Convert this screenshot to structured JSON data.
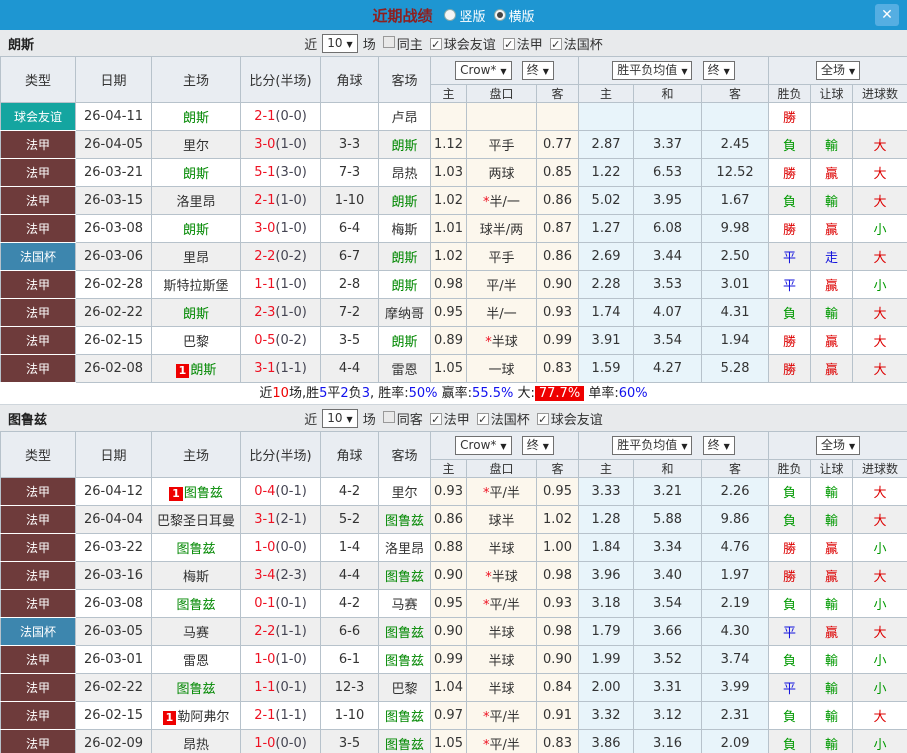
{
  "titlebar": {
    "title": "近期战绩",
    "radio_vertical": "竖版",
    "radio_horizontal": "横版",
    "close_glyph": "✕"
  },
  "colors": {
    "topbar": "#1e96d2",
    "friendly": "#14a5a0",
    "ligue1": "#6e3b3b",
    "cup": "#3d86ae",
    "win": "#dd0000",
    "loss": "#009900",
    "draw": "#1111dd",
    "team_highlight": "#008800",
    "summary_highlight": "#ee0000"
  },
  "table_header": {
    "type": "类型",
    "date": "日期",
    "home": "主场",
    "score": "比分(半场)",
    "corner": "角球",
    "away": "客场",
    "h": "主",
    "line": "盘口",
    "a": "客",
    "h2": "主",
    "d": "和",
    "a2": "客",
    "res": "胜负",
    "han": "让球",
    "goal": "进球数",
    "sel_crow": "Crow*",
    "sel_final": "终",
    "sel_avg": "胜平负均值",
    "sel_scope": "全场"
  },
  "sections": [
    {
      "team": "朗斯",
      "filter": {
        "near": "近",
        "count": "10",
        "games": "场",
        "checks": [
          {
            "label": "同主",
            "checked": false
          },
          {
            "label": "球会友谊",
            "checked": true
          },
          {
            "label": "法甲",
            "checked": true
          },
          {
            "label": "法国杯",
            "checked": true
          }
        ]
      },
      "rows": [
        {
          "type": "球会友谊",
          "type_c": "friendly",
          "date": "26-04-11",
          "badge": "",
          "home": "朗斯",
          "home_c": "gr",
          "score": "2-1",
          "half": "(0-0)",
          "corner": "",
          "away": "卢昂",
          "away_c": "",
          "o_h": "",
          "o_star": "",
          "o_line": "",
          "o_a": "",
          "e_h": "",
          "e_d": "",
          "e_a": "",
          "res": "勝",
          "res_c": "r",
          "han": "",
          "han_c": "",
          "goal": "",
          "goal_c": ""
        },
        {
          "type": "法甲",
          "type_c": "ligue",
          "date": "26-04-05",
          "badge": "",
          "home": "里尔",
          "home_c": "",
          "score": "3-0",
          "half": "(1-0)",
          "corner": "3-3",
          "away": "朗斯",
          "away_c": "gr",
          "o_h": "1.12",
          "o_star": "",
          "o_line": "平手",
          "o_a": "0.77",
          "e_h": "2.87",
          "e_d": "3.37",
          "e_a": "2.45",
          "res": "負",
          "res_c": "g",
          "han": "輸",
          "han_c": "g",
          "goal": "大",
          "goal_c": "r"
        },
        {
          "type": "法甲",
          "type_c": "ligue",
          "date": "26-03-21",
          "badge": "",
          "home": "朗斯",
          "home_c": "gr",
          "score": "5-1",
          "half": "(3-0)",
          "corner": "7-3",
          "away": "昂热",
          "away_c": "",
          "o_h": "1.03",
          "o_star": "",
          "o_line": "两球",
          "o_a": "0.85",
          "e_h": "1.22",
          "e_d": "6.53",
          "e_a": "12.52",
          "res": "勝",
          "res_c": "r",
          "han": "贏",
          "han_c": "r",
          "goal": "大",
          "goal_c": "r"
        },
        {
          "type": "法甲",
          "type_c": "ligue",
          "date": "26-03-15",
          "badge": "",
          "home": "洛里昂",
          "home_c": "",
          "score": "2-1",
          "half": "(1-0)",
          "corner": "1-10",
          "away": "朗斯",
          "away_c": "gr",
          "o_h": "1.02",
          "o_star": "*",
          "o_line": "半/一",
          "o_a": "0.86",
          "e_h": "5.02",
          "e_d": "3.95",
          "e_a": "1.67",
          "res": "負",
          "res_c": "g",
          "han": "輸",
          "han_c": "g",
          "goal": "大",
          "goal_c": "r"
        },
        {
          "type": "法甲",
          "type_c": "ligue",
          "date": "26-03-08",
          "badge": "",
          "home": "朗斯",
          "home_c": "gr",
          "score": "3-0",
          "half": "(1-0)",
          "corner": "6-4",
          "away": "梅斯",
          "away_c": "",
          "o_h": "1.01",
          "o_star": "",
          "o_line": "球半/两",
          "o_a": "0.87",
          "e_h": "1.27",
          "e_d": "6.08",
          "e_a": "9.98",
          "res": "勝",
          "res_c": "r",
          "han": "贏",
          "han_c": "r",
          "goal": "小",
          "goal_c": "g"
        },
        {
          "type": "法国杯",
          "type_c": "cup",
          "date": "26-03-06",
          "badge": "",
          "home": "里昂",
          "home_c": "",
          "score": "2-2",
          "half": "(0-2)",
          "corner": "6-7",
          "away": "朗斯",
          "away_c": "gr",
          "o_h": "1.02",
          "o_star": "",
          "o_line": "平手",
          "o_a": "0.86",
          "e_h": "2.69",
          "e_d": "3.44",
          "e_a": "2.50",
          "res": "平",
          "res_c": "b",
          "han": "走",
          "han_c": "b",
          "goal": "大",
          "goal_c": "r"
        },
        {
          "type": "法甲",
          "type_c": "ligue",
          "date": "26-02-28",
          "badge": "",
          "home": "斯特拉斯堡",
          "home_c": "",
          "score": "1-1",
          "half": "(1-0)",
          "corner": "2-8",
          "away": "朗斯",
          "away_c": "gr",
          "o_h": "0.98",
          "o_star": "",
          "o_line": "平/半",
          "o_a": "0.90",
          "e_h": "2.28",
          "e_d": "3.53",
          "e_a": "3.01",
          "res": "平",
          "res_c": "b",
          "han": "贏",
          "han_c": "r",
          "goal": "小",
          "goal_c": "g"
        },
        {
          "type": "法甲",
          "type_c": "ligue",
          "date": "26-02-22",
          "badge": "",
          "home": "朗斯",
          "home_c": "gr",
          "score": "2-3",
          "half": "(1-0)",
          "corner": "7-2",
          "away": "摩纳哥",
          "away_c": "",
          "o_h": "0.95",
          "o_star": "",
          "o_line": "半/一",
          "o_a": "0.93",
          "e_h": "1.74",
          "e_d": "4.07",
          "e_a": "4.31",
          "res": "負",
          "res_c": "g",
          "han": "輸",
          "han_c": "g",
          "goal": "大",
          "goal_c": "r"
        },
        {
          "type": "法甲",
          "type_c": "ligue",
          "date": "26-02-15",
          "badge": "",
          "home": "巴黎",
          "home_c": "",
          "score": "0-5",
          "half": "(0-2)",
          "corner": "3-5",
          "away": "朗斯",
          "away_c": "gr",
          "o_h": "0.89",
          "o_star": "*",
          "o_line": "半球",
          "o_a": "0.99",
          "e_h": "3.91",
          "e_d": "3.54",
          "e_a": "1.94",
          "res": "勝",
          "res_c": "r",
          "han": "贏",
          "han_c": "r",
          "goal": "大",
          "goal_c": "r"
        },
        {
          "type": "法甲",
          "type_c": "ligue",
          "date": "26-02-08",
          "badge": "1",
          "home": "朗斯",
          "home_c": "gr",
          "score": "3-1",
          "half": "(1-1)",
          "corner": "4-4",
          "away": "雷恩",
          "away_c": "",
          "o_h": "1.05",
          "o_star": "",
          "o_line": "一球",
          "o_a": "0.83",
          "e_h": "1.59",
          "e_d": "4.27",
          "e_a": "5.28",
          "res": "勝",
          "res_c": "r",
          "han": "贏",
          "han_c": "r",
          "goal": "大",
          "goal_c": "r"
        }
      ],
      "summary": [
        {
          "t": "近",
          "c": "k"
        },
        {
          "t": "10",
          "c": "r"
        },
        {
          "t": "场,胜",
          "c": "k"
        },
        {
          "t": "5",
          "c": "b"
        },
        {
          "t": "平",
          "c": "k"
        },
        {
          "t": "2",
          "c": "b"
        },
        {
          "t": "负",
          "c": "k"
        },
        {
          "t": "3",
          "c": "b"
        },
        {
          "t": ", 胜率:",
          "c": "k"
        },
        {
          "t": "50%",
          "c": "b"
        },
        {
          "t": " 赢率:",
          "c": "k"
        },
        {
          "t": "55.5%",
          "c": "b"
        },
        {
          "t": " 大:",
          "c": "k"
        },
        {
          "t": "77.7%",
          "c": "hl"
        },
        {
          "t": " 单率:",
          "c": "k"
        },
        {
          "t": "60%",
          "c": "b"
        }
      ]
    },
    {
      "team": "图鲁兹",
      "filter": {
        "near": "近",
        "count": "10",
        "games": "场",
        "checks": [
          {
            "label": "同客",
            "checked": false
          },
          {
            "label": "法甲",
            "checked": true
          },
          {
            "label": "法国杯",
            "checked": true
          },
          {
            "label": "球会友谊",
            "checked": true
          }
        ]
      },
      "rows": [
        {
          "type": "法甲",
          "type_c": "ligue",
          "date": "26-04-12",
          "badge": "1",
          "home": "图鲁兹",
          "home_c": "gr",
          "score": "0-4",
          "half": "(0-1)",
          "corner": "4-2",
          "away": "里尔",
          "away_c": "",
          "o_h": "0.93",
          "o_star": "*",
          "o_line": "平/半",
          "o_a": "0.95",
          "e_h": "3.33",
          "e_d": "3.21",
          "e_a": "2.26",
          "res": "負",
          "res_c": "g",
          "han": "輸",
          "han_c": "g",
          "goal": "大",
          "goal_c": "r"
        },
        {
          "type": "法甲",
          "type_c": "ligue",
          "date": "26-04-04",
          "badge": "",
          "home": "巴黎圣日耳曼",
          "home_c": "",
          "score": "3-1",
          "half": "(2-1)",
          "corner": "5-2",
          "away": "图鲁兹",
          "away_c": "gr",
          "o_h": "0.86",
          "o_star": "",
          "o_line": "球半",
          "o_a": "1.02",
          "e_h": "1.28",
          "e_d": "5.88",
          "e_a": "9.86",
          "res": "負",
          "res_c": "g",
          "han": "輸",
          "han_c": "g",
          "goal": "大",
          "goal_c": "r"
        },
        {
          "type": "法甲",
          "type_c": "ligue",
          "date": "26-03-22",
          "badge": "",
          "home": "图鲁兹",
          "home_c": "gr",
          "score": "1-0",
          "half": "(0-0)",
          "corner": "1-4",
          "away": "洛里昂",
          "away_c": "",
          "o_h": "0.88",
          "o_star": "",
          "o_line": "半球",
          "o_a": "1.00",
          "e_h": "1.84",
          "e_d": "3.34",
          "e_a": "4.76",
          "res": "勝",
          "res_c": "r",
          "han": "贏",
          "han_c": "r",
          "goal": "小",
          "goal_c": "g"
        },
        {
          "type": "法甲",
          "type_c": "ligue",
          "date": "26-03-16",
          "badge": "",
          "home": "梅斯",
          "home_c": "",
          "score": "3-4",
          "half": "(2-3)",
          "corner": "4-4",
          "away": "图鲁兹",
          "away_c": "gr",
          "o_h": "0.90",
          "o_star": "*",
          "o_line": "半球",
          "o_a": "0.98",
          "e_h": "3.96",
          "e_d": "3.40",
          "e_a": "1.97",
          "res": "勝",
          "res_c": "r",
          "han": "贏",
          "han_c": "r",
          "goal": "大",
          "goal_c": "r"
        },
        {
          "type": "法甲",
          "type_c": "ligue",
          "date": "26-03-08",
          "badge": "",
          "home": "图鲁兹",
          "home_c": "gr",
          "score": "0-1",
          "half": "(0-1)",
          "corner": "4-2",
          "away": "马赛",
          "away_c": "",
          "o_h": "0.95",
          "o_star": "*",
          "o_line": "平/半",
          "o_a": "0.93",
          "e_h": "3.18",
          "e_d": "3.54",
          "e_a": "2.19",
          "res": "負",
          "res_c": "g",
          "han": "輸",
          "han_c": "g",
          "goal": "小",
          "goal_c": "g"
        },
        {
          "type": "法国杯",
          "type_c": "cup",
          "date": "26-03-05",
          "badge": "",
          "home": "马赛",
          "home_c": "",
          "score": "2-2",
          "half": "(1-1)",
          "corner": "6-6",
          "away": "图鲁兹",
          "away_c": "gr",
          "o_h": "0.90",
          "o_star": "",
          "o_line": "半球",
          "o_a": "0.98",
          "e_h": "1.79",
          "e_d": "3.66",
          "e_a": "4.30",
          "res": "平",
          "res_c": "b",
          "han": "贏",
          "han_c": "r",
          "goal": "大",
          "goal_c": "r"
        },
        {
          "type": "法甲",
          "type_c": "ligue",
          "date": "26-03-01",
          "badge": "",
          "home": "雷恩",
          "home_c": "",
          "score": "1-0",
          "half": "(1-0)",
          "corner": "6-1",
          "away": "图鲁兹",
          "away_c": "gr",
          "o_h": "0.99",
          "o_star": "",
          "o_line": "半球",
          "o_a": "0.90",
          "e_h": "1.99",
          "e_d": "3.52",
          "e_a": "3.74",
          "res": "負",
          "res_c": "g",
          "han": "輸",
          "han_c": "g",
          "goal": "小",
          "goal_c": "g"
        },
        {
          "type": "法甲",
          "type_c": "ligue",
          "date": "26-02-22",
          "badge": "",
          "home": "图鲁兹",
          "home_c": "gr",
          "score": "1-1",
          "half": "(0-1)",
          "corner": "12-3",
          "away": "巴黎",
          "away_c": "",
          "o_h": "1.04",
          "o_star": "",
          "o_line": "半球",
          "o_a": "0.84",
          "e_h": "2.00",
          "e_d": "3.31",
          "e_a": "3.99",
          "res": "平",
          "res_c": "b",
          "han": "輸",
          "han_c": "g",
          "goal": "小",
          "goal_c": "g"
        },
        {
          "type": "法甲",
          "type_c": "ligue",
          "date": "26-02-15",
          "badge": "1",
          "home": "勒阿弗尔",
          "home_c": "",
          "score": "2-1",
          "half": "(1-1)",
          "corner": "1-10",
          "away": "图鲁兹",
          "away_c": "gr",
          "o_h": "0.97",
          "o_star": "*",
          "o_line": "平/半",
          "o_a": "0.91",
          "e_h": "3.32",
          "e_d": "3.12",
          "e_a": "2.31",
          "res": "負",
          "res_c": "g",
          "han": "輸",
          "han_c": "g",
          "goal": "大",
          "goal_c": "r"
        },
        {
          "type": "法甲",
          "type_c": "ligue",
          "date": "26-02-09",
          "badge": "",
          "home": "昂热",
          "home_c": "",
          "score": "1-0",
          "half": "(0-0)",
          "corner": "3-5",
          "away": "图鲁兹",
          "away_c": "gr",
          "o_h": "1.05",
          "o_star": "*",
          "o_line": "平/半",
          "o_a": "0.83",
          "e_h": "3.86",
          "e_d": "3.16",
          "e_a": "2.09",
          "res": "負",
          "res_c": "g",
          "han": "輸",
          "han_c": "g",
          "goal": "小",
          "goal_c": "g"
        }
      ],
      "summary": []
    }
  ]
}
